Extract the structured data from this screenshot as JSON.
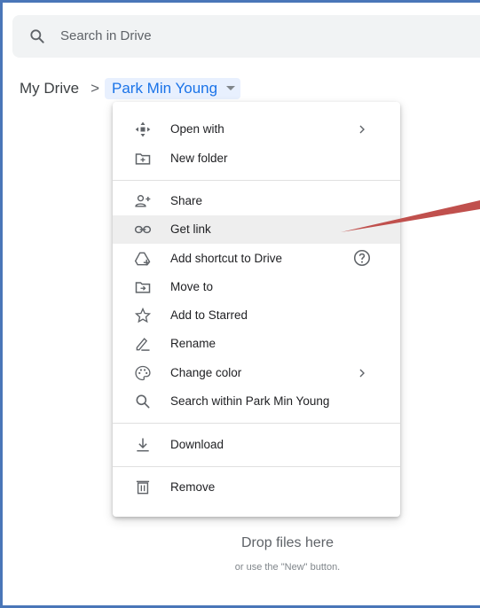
{
  "search": {
    "placeholder": "Search in Drive"
  },
  "breadcrumb": {
    "root": "My Drive",
    "separator": ">",
    "current": "Park Min Young"
  },
  "context_menu": {
    "items": [
      {
        "label": "Open with",
        "icon": "open-with-icon",
        "has_submenu": true
      },
      {
        "label": "New folder",
        "icon": "new-folder-icon"
      },
      {
        "label": "Share",
        "icon": "share-person-add-icon"
      },
      {
        "label": "Get link",
        "icon": "link-icon",
        "highlighted": true
      },
      {
        "label": "Add shortcut to Drive",
        "icon": "add-shortcut-icon",
        "has_help": true
      },
      {
        "label": "Move to",
        "icon": "move-to-icon"
      },
      {
        "label": "Add to Starred",
        "icon": "star-icon"
      },
      {
        "label": "Rename",
        "icon": "rename-pencil-icon"
      },
      {
        "label": "Change color",
        "icon": "palette-icon",
        "has_submenu": true
      },
      {
        "label": "Search within Park Min Young",
        "icon": "search-icon"
      },
      {
        "label": "Download",
        "icon": "download-icon"
      },
      {
        "label": "Remove",
        "icon": "trash-icon"
      }
    ]
  },
  "empty_state": {
    "title": "Drop files here",
    "subtitle": "or use the \"New\" button."
  },
  "colors": {
    "accent_blue": "#1a73e8",
    "frame_blue": "#4a76b8",
    "highlight_grey": "#eeeeee",
    "annotation_arrow": "#c0504d"
  }
}
